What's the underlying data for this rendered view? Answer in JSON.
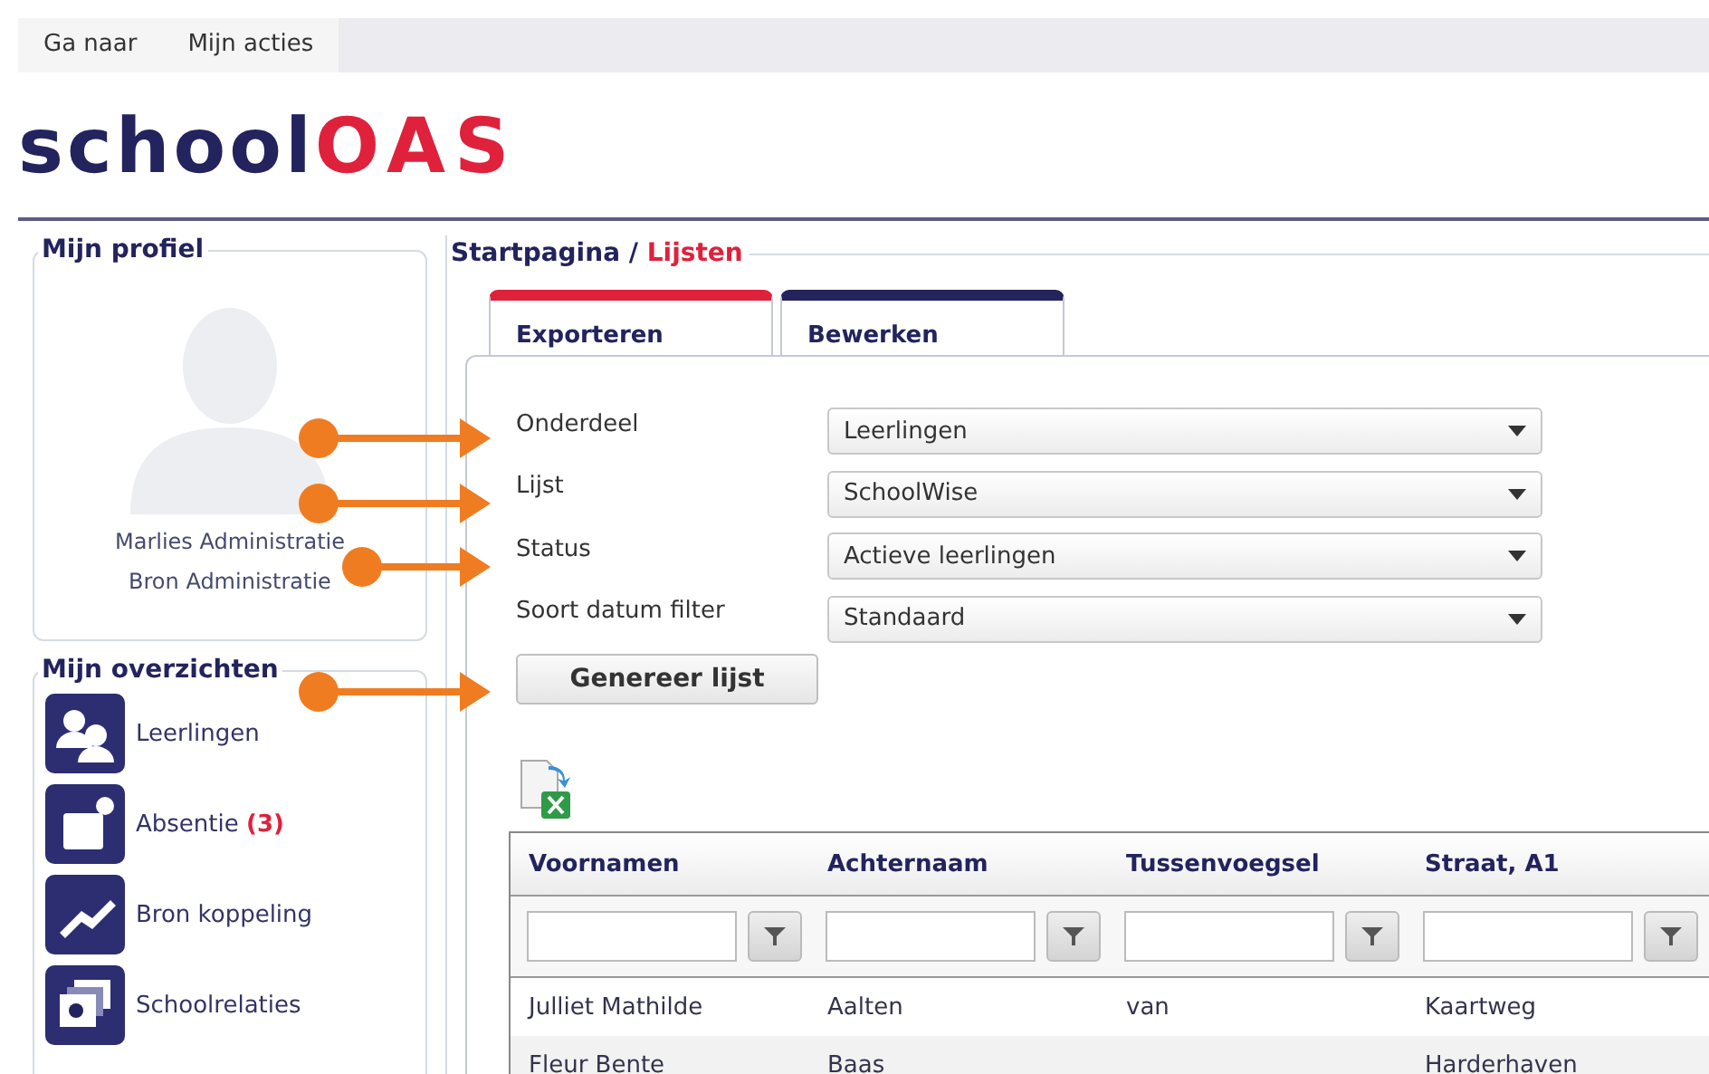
{
  "menu": [
    "Ga naar",
    "Mijn acties"
  ],
  "logo": {
    "first": "school",
    "second": "OAS"
  },
  "profile": {
    "title": "Mijn profiel",
    "lines": [
      "Marlies Administratie",
      "Bron Administratie"
    ]
  },
  "overviews": {
    "title": "Mijn overzichten",
    "items": [
      {
        "label": "Leerlingen"
      },
      {
        "label": "Absentie",
        "count": "(3)"
      },
      {
        "label": "Bron koppeling"
      },
      {
        "label": "Schoolrelaties"
      }
    ]
  },
  "breadcrumb": {
    "parent": "Startpagina /",
    "current": "Lijsten"
  },
  "tabs": [
    {
      "label": "Exporteren",
      "selected": true
    },
    {
      "label": "Bewerken",
      "selected": false
    }
  ],
  "form": [
    {
      "label": "Onderdeel",
      "value": "Leerlingen"
    },
    {
      "label": "Lijst",
      "value": "SchoolWise"
    },
    {
      "label": "Status",
      "value": "Actieve leerlingen"
    },
    {
      "label": "Soort datum filter",
      "value": "Standaard"
    }
  ],
  "generate_button": "Genereer lijst",
  "table": {
    "columns": [
      "Voornamen",
      "Achternaam",
      "Tussenvoegsel",
      "Straat, A1"
    ],
    "rows": [
      [
        "Julliet Mathilde",
        "Aalten",
        "van",
        "Kaartweg"
      ],
      [
        "Fleur Bente",
        "Baas",
        "",
        "Harderhaven"
      ]
    ]
  }
}
